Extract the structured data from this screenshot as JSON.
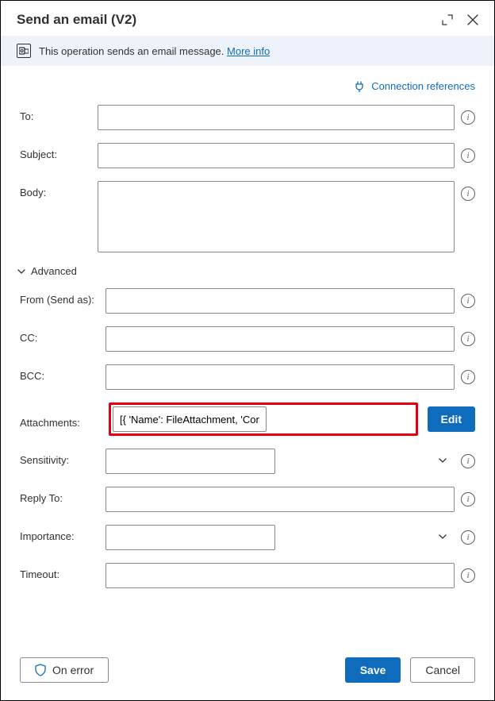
{
  "header": {
    "title": "Send an email (V2)"
  },
  "infobar": {
    "text": "This operation sends an email message.",
    "more_info": "More info"
  },
  "conn_ref": "Connection references",
  "fields": {
    "to": "To:",
    "subject": "Subject:",
    "body": "Body:",
    "from": "From (Send as):",
    "cc": "CC:",
    "bcc": "BCC:",
    "attachments": "Attachments:",
    "sensitivity": "Sensitivity:",
    "reply_to": "Reply To:",
    "importance": "Importance:",
    "timeout": "Timeout:"
  },
  "values": {
    "attachments": "[{ 'Name': FileAttachment, 'ContentBytes': %BinaryData% }]"
  },
  "section": {
    "advanced": "Advanced"
  },
  "buttons": {
    "edit": "Edit",
    "save": "Save",
    "cancel": "Cancel",
    "on_error": "On error"
  }
}
